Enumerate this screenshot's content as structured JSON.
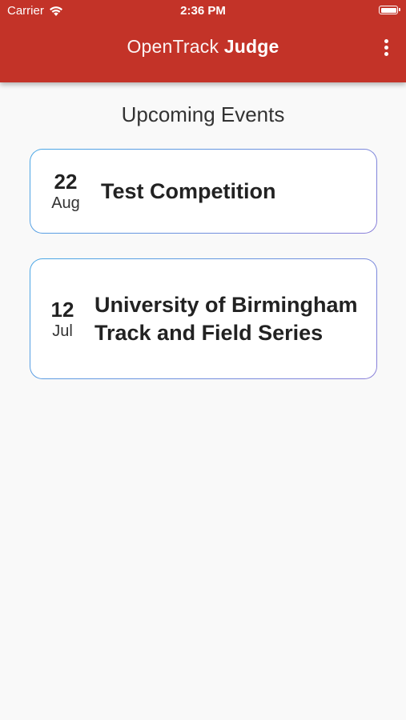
{
  "status_bar": {
    "carrier": "Carrier",
    "time": "2:36 PM"
  },
  "app_bar": {
    "title_regular": "OpenTrack",
    "title_bold": "Judge",
    "background_color": "#c33328"
  },
  "main": {
    "section_title": "Upcoming Events",
    "events": [
      {
        "day": "22",
        "month": "Aug",
        "name": "Test Competition"
      },
      {
        "day": "12",
        "month": "Jul",
        "name": "University of Birmingham Track and Field Series"
      }
    ]
  }
}
